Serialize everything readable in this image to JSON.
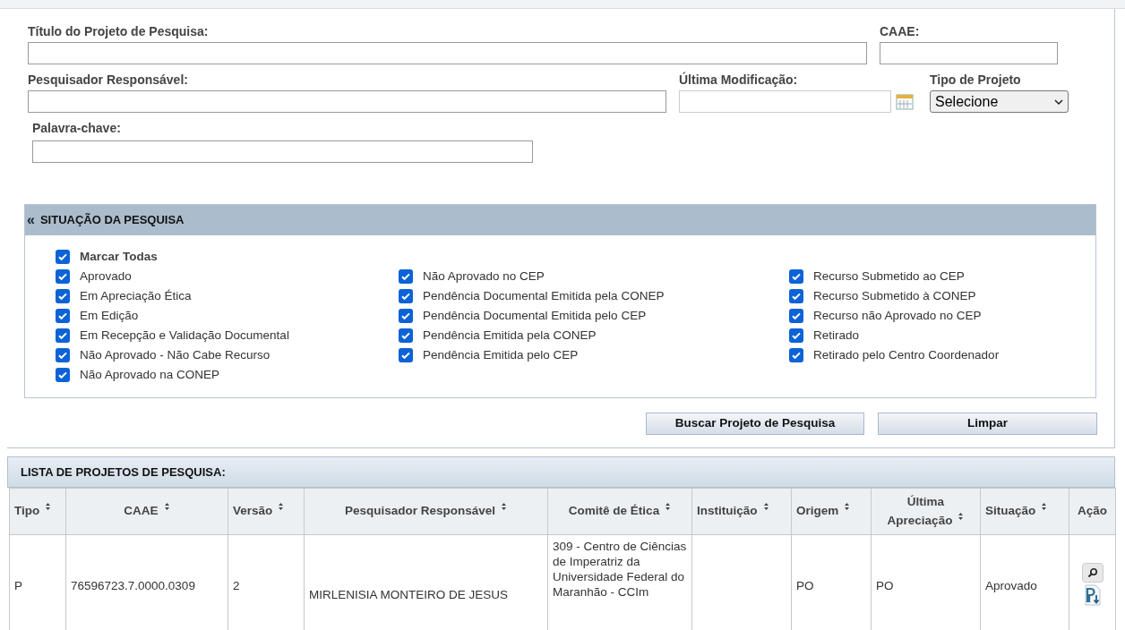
{
  "form": {
    "fields": [
      {
        "label": "Título do Projeto de Pesquisa:"
      },
      {
        "label": "CAAE:"
      },
      {
        "label": "Pesquisador Responsável:"
      },
      {
        "label": "Última Modificação:"
      },
      {
        "label": "Tipo de Projeto",
        "value": "Selecione"
      },
      {
        "label": "Palavra-chave:"
      }
    ]
  },
  "situacao": {
    "title": "SITUAÇÃO DA PESQUISA",
    "toggle": "«",
    "mark_all": {
      "label": "Marcar Todas",
      "checked": true
    },
    "columns": [
      [
        {
          "label": "Aprovado",
          "checked": true
        },
        {
          "label": "Em Apreciação Ética",
          "checked": true
        },
        {
          "label": "Em Edição",
          "checked": true
        },
        {
          "label": "Em Recepção e Validação Documental",
          "checked": true
        },
        {
          "label": "Não Aprovado - Não Cabe Recurso",
          "checked": true
        },
        {
          "label": "Não Aprovado na CONEP",
          "checked": true
        }
      ],
      [
        {
          "label": "Não Aprovado no CEP",
          "checked": true
        },
        {
          "label": "Pendência Documental Emitida pela CONEP",
          "checked": true
        },
        {
          "label": "Pendência Documental Emitida pelo CEP",
          "checked": true
        },
        {
          "label": "Pendência Emitida pela CONEP",
          "checked": true
        },
        {
          "label": "Pendência Emitida pelo CEP",
          "checked": true
        }
      ],
      [
        {
          "label": "Recurso Submetido ao CEP",
          "checked": true
        },
        {
          "label": "Recurso Submetido à CONEP",
          "checked": true
        },
        {
          "label": "Recurso não Aprovado no CEP",
          "checked": true
        },
        {
          "label": "Retirado",
          "checked": true
        },
        {
          "label": "Retirado pelo Centro Coordenador",
          "checked": true
        }
      ]
    ]
  },
  "buttons": [
    "Buscar Projeto de Pesquisa",
    "Limpar"
  ],
  "table": {
    "title": "LISTA DE PROJETOS DE PESQUISA:",
    "columns": [
      {
        "label": "Tipo",
        "sortable": true
      },
      {
        "label": "CAAE",
        "sortable": true
      },
      {
        "label": "Versão",
        "sortable": true
      },
      {
        "label": "Pesquisador Responsável",
        "sortable": true
      },
      {
        "label": "Comitê de Ética",
        "sortable": true
      },
      {
        "label": "Instituição",
        "sortable": true
      },
      {
        "label": "Origem",
        "sortable": true
      },
      {
        "label": "Última Apreciação",
        "sortable": true
      },
      {
        "label": "Situação",
        "sortable": true
      },
      {
        "label": "Ação",
        "sortable": false
      }
    ],
    "rows": [
      {
        "cells": [
          "P",
          "76596723.7.0000.0309",
          "2",
          "MIRLENISIA MONTEIRO DE JESUS",
          "309 - Centro de Ciências de Imperatriz da Universidade Federal do Maranhão - CCIm",
          "",
          "PO",
          "PO",
          "Aprovado"
        ]
      }
    ]
  }
}
